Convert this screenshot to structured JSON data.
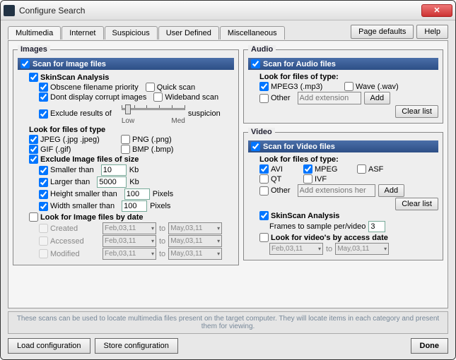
{
  "window": {
    "title": "Configure Search"
  },
  "header": {
    "tabs": [
      "Multimedia",
      "Internet",
      "Suspicious",
      "User Defined",
      "Miscellaneous"
    ],
    "page_defaults": "Page defaults",
    "help": "Help"
  },
  "images": {
    "legend": "Images",
    "scan": "Scan for Image files",
    "skinscan": "SkinScan Analysis",
    "obscene": "Obscene filename priority",
    "quick": "Quick scan",
    "corrupt": "Dont display corrupt images",
    "wideband": "Wideband scan",
    "exclude_results": "Exclude results of",
    "suspicion": "suspicion",
    "slider_low": "Low",
    "slider_med": "Med",
    "look_type": "Look for files of type",
    "jpeg": "JPEG  (.jpg .jpeg)",
    "png": "PNG (.png)",
    "gif": "GIF  (.gif)",
    "bmp": "BMP (.bmp)",
    "exclude_size": "Exclude Image files of size",
    "smaller": "Smaller than",
    "smaller_val": "10",
    "kb": "Kb",
    "larger": "Larger than",
    "larger_val": "5000",
    "height_smaller": "Height smaller than",
    "height_val": "100",
    "pixels": "Pixels",
    "width_smaller": "Width smaller than",
    "width_val": "100",
    "by_date": "Look for Image files by date",
    "created": "Created",
    "accessed": "Accessed",
    "modified": "Modified",
    "to": "to",
    "date_from": "Feb,03,11",
    "date_to": "May,03,11"
  },
  "audio": {
    "legend": "Audio",
    "scan": "Scan for Audio files",
    "look_type": "Look for files of type:",
    "mpeg3": "MPEG3  (.mp3)",
    "wave": "Wave  (.wav)",
    "other": "Other",
    "add_ext_ph": "Add extension",
    "add": "Add",
    "clear": "Clear list"
  },
  "video": {
    "legend": "Video",
    "scan": "Scan for Video files",
    "look_type": "Look for files of type:",
    "avi": "AVI",
    "mpeg": "MPEG",
    "asf": "ASF",
    "qt": "QT",
    "ivf": "IVF",
    "other": "Other",
    "add_ext_ph": "Add extensions her",
    "add": "Add",
    "clear": "Clear list",
    "skinscan": "SkinScan Analysis",
    "frames_label": "Frames to sample per/video",
    "frames_val": "3",
    "by_date": "Look for video's by access date",
    "date_from": "Feb,03,11",
    "to": "to",
    "date_to": "May,03,11"
  },
  "footer": {
    "note": "These scans can be used to locate multimedia files present on the target computer. They will locate items in each category and present them for viewing.",
    "load": "Load configuration",
    "store": "Store configuration",
    "done": "Done"
  }
}
